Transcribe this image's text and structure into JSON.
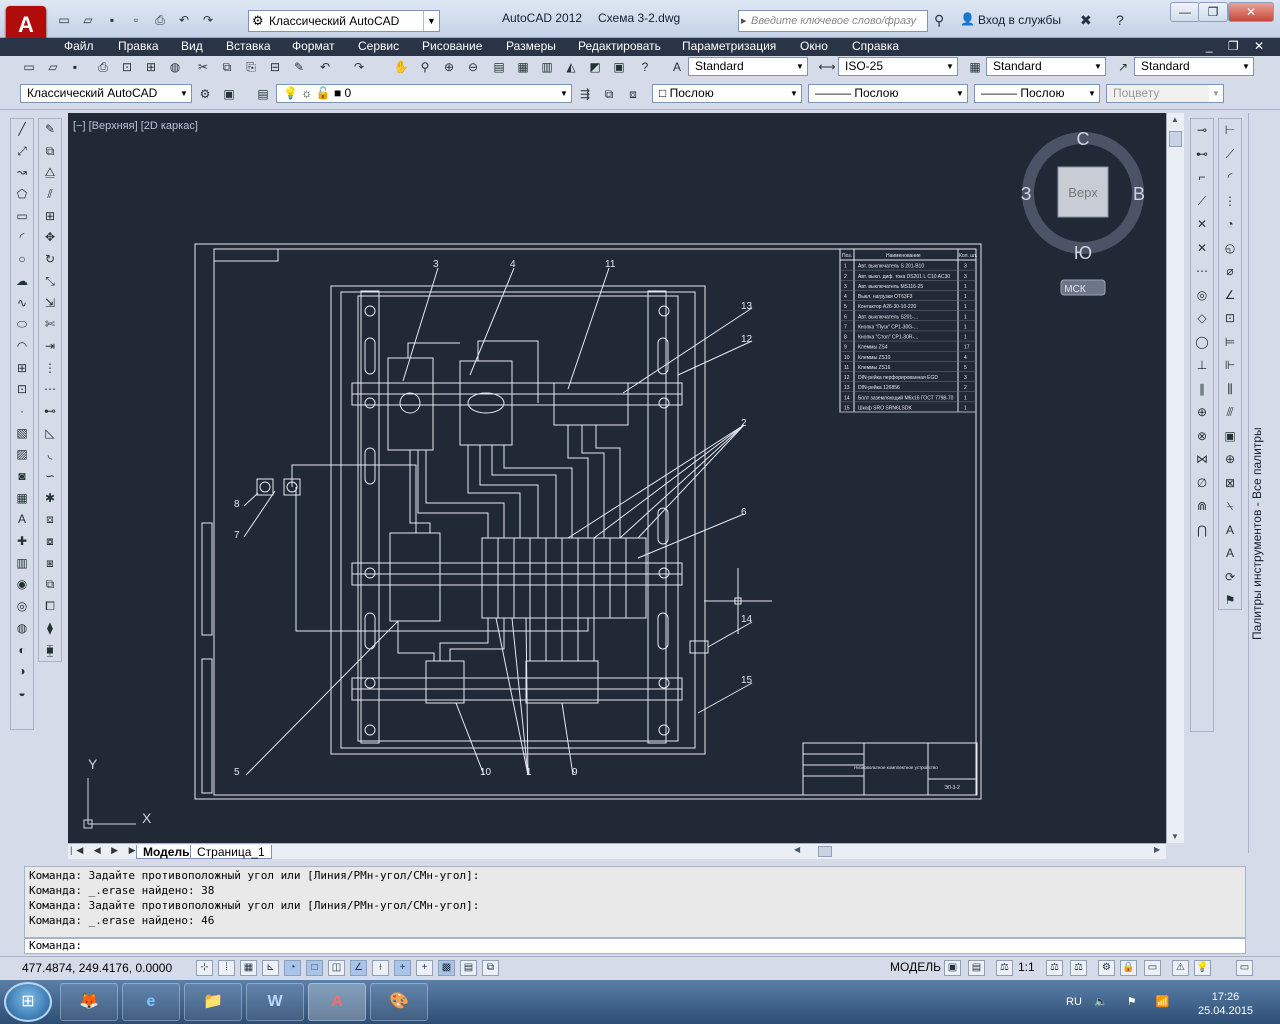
{
  "title_bar": {
    "app_button_label": "A",
    "workspace": "Классический AutoCAD",
    "app_name": "AutoCAD 2012",
    "document": "Схема 3-2.dwg",
    "search_placeholder": "Введите ключевое слово/фразу",
    "login": "Вход в службы",
    "minimize": "—",
    "restore": "❐",
    "close": "✕"
  },
  "menu": [
    "Файл",
    "Правка",
    "Вид",
    "Вставка",
    "Формат",
    "Сервис",
    "Рисование",
    "Размеры",
    "Редактировать",
    "Параметризация",
    "Окно",
    "Справка"
  ],
  "mdi_buttons": "_ ❐ ✕",
  "toolbar": {
    "text_style": "Standard",
    "dim_style": "ISO-25",
    "table_style": "Standard",
    "mleader_style": "Standard",
    "workspace_combo": "Классический AutoCAD",
    "layer": "0",
    "color": "Послою",
    "linetype": "Послою",
    "lineweight": "Послою",
    "plotstyle": "Поцвету"
  },
  "viewport": {
    "label": "[−] [Верхняя] [2D каркас]",
    "viewcube_face": "Верх",
    "north": "С",
    "south": "Ю",
    "east": "В",
    "west": "З",
    "ucs": "МСК",
    "ucs_y": "Y",
    "ucs_x": "X"
  },
  "drawing": {
    "callouts": [
      "3",
      "4",
      "11",
      "13",
      "12",
      "2",
      "6",
      "8",
      "7",
      "14",
      "15",
      "5",
      "10",
      "1",
      "9"
    ],
    "bom_header": [
      "Поз.",
      "Наименование",
      "Кол. шт."
    ],
    "bom_rows": [
      [
        "1",
        "Авт. выключатель S 201-B10",
        "3"
      ],
      [
        "2",
        "Авт. выкл. диф. тока DS201 L C10 AC30",
        "3"
      ],
      [
        "3",
        "Авт. выключатель MS116-25",
        "1"
      ],
      [
        "4",
        "Выкл. нагрузки OT63F3",
        "1"
      ],
      [
        "5",
        "Контактор A26-30-10-220",
        "1"
      ],
      [
        "6",
        "Авт. выключатель S201-...",
        "1"
      ],
      [
        "7",
        "Кнопка \"Пуск\" CP1-30G-...",
        "1"
      ],
      [
        "8",
        "Кнопка \"Стоп\" CP1-30R-...",
        "1"
      ],
      [
        "9",
        "Клеммы ZS4",
        "17"
      ],
      [
        "10",
        "Клеммы ZS10",
        "4"
      ],
      [
        "11",
        "Клеммы ZS16",
        "5"
      ],
      [
        "12",
        "DIN-рейка перфорированная EGD",
        "3"
      ],
      [
        "13",
        "DIN-рейка 126856",
        "2"
      ],
      [
        "14",
        "Болт заземляющий М6х16 ГОСТ 7798-70",
        "1"
      ],
      [
        "15",
        "Шкаф SRO SRN6LSDK",
        "1"
      ]
    ],
    "stamp_title": "Низковольтное комплектное устройство",
    "stamp_code": "ЭЛ-3-2"
  },
  "tabs": [
    "Модель",
    "Страница_1"
  ],
  "command": {
    "history": [
      "Команда: Задайте противоположный угол или [Линия/РМн-угол/СМн-угол]:",
      "Команда: _.erase найдено: 38",
      "Команда: Задайте противоположный угол или [Линия/РМн-угол/СМн-угол]:",
      "Команда: _.erase найдено: 46"
    ],
    "prompt": "Команда:"
  },
  "status": {
    "coords": "477.4874, 249.4176, 0.0000",
    "space": "МОДЕЛЬ",
    "scale": "1:1"
  },
  "palette_label": "Палитры инструментов - Все палитры",
  "taskbar": {
    "apps": [
      "🦊",
      "e",
      "📁",
      "W",
      "A",
      "🎨"
    ],
    "language": "RU",
    "tray": "🔈 ⚑ 📶",
    "time": "17:26",
    "date": "25.04.2015"
  }
}
